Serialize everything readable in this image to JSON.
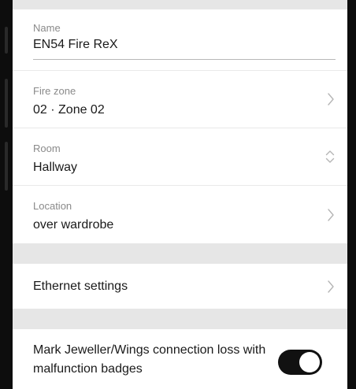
{
  "settings": {
    "name": {
      "label": "Name",
      "value": "EN54 Fire ReX"
    },
    "fire_zone": {
      "label": "Fire zone",
      "value": "02 · Zone 02",
      "icon": "chevron-right-icon"
    },
    "room": {
      "label": "Room",
      "value": "Hallway",
      "icon": "chevron-up-down-icon"
    },
    "location": {
      "label": "Location",
      "value": "over wardrobe",
      "icon": "chevron-right-icon"
    },
    "ethernet": {
      "label": "Ethernet settings",
      "icon": "chevron-right-icon"
    },
    "malfunction_toggle": {
      "label": "Mark Jeweller/Wings connection loss with malfunction badges",
      "state": "on"
    }
  },
  "colors": {
    "background": "#e6e6e6",
    "card": "#ffffff",
    "toggle_on": "#111111",
    "label": "#8a8a8a",
    "text": "#1a1a1a"
  }
}
